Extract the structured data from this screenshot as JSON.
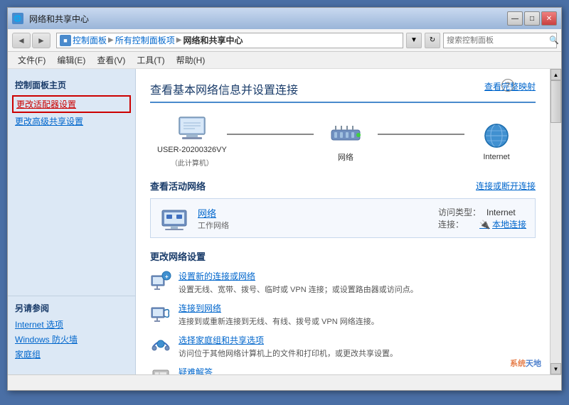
{
  "window": {
    "title": "网络和共享中心",
    "title_buttons": {
      "minimize": "—",
      "maximize": "□",
      "close": "✕"
    }
  },
  "address_bar": {
    "nav_back": "◄",
    "nav_fwd": "►",
    "breadcrumb_icon": "■",
    "breadcrumb_items": [
      "控制面板",
      "所有控制面板项",
      "网络和共享中心"
    ],
    "separator": "▶",
    "arrow_label": "▼",
    "search_placeholder": "搜索控制面板",
    "search_icon": "🔍"
  },
  "menu_bar": {
    "items": [
      "文件(F)",
      "编辑(E)",
      "查看(V)",
      "工具(T)",
      "帮助(H)"
    ]
  },
  "sidebar": {
    "section_title": "控制面板主页",
    "links": [
      {
        "label": "更改适配器设置",
        "highlighted": true
      },
      {
        "label": "更改高级共享设置",
        "highlighted": false
      }
    ],
    "also_section_title": "另请参阅",
    "also_links": [
      "Internet 选项",
      "Windows 防火墙",
      "家庭组"
    ]
  },
  "content": {
    "title": "查看基本网络信息并设置连接",
    "view_map_link": "查看完整映射",
    "network_nodes": [
      {
        "label": "USER-20200326VY",
        "sublabel": "（此计算机）"
      },
      {
        "label": "网络",
        "sublabel": ""
      },
      {
        "label": "Internet",
        "sublabel": ""
      }
    ],
    "active_networks_section": "查看活动网络",
    "disconnect_link": "连接或断开连接",
    "active_network": {
      "name": "网络",
      "type": "工作网络",
      "access_type_label": "访问类型：",
      "access_type_value": "Internet",
      "connection_label": "连接：",
      "connection_value": "本地连接"
    },
    "change_settings_title": "更改网络设置",
    "settings_items": [
      {
        "title": "设置新的连接或网络",
        "desc": "设置无线、宽带、拨号、临时或 VPN 连接；或设置路由器或访问点。"
      },
      {
        "title": "连接到网络",
        "desc": "连接到或重新连接到无线、有线、拨号或 VPN 网络连接。"
      },
      {
        "title": "选择家庭组和共享选项",
        "desc": "访问位于其他网络计算机上的文件和打印机，或更改共享设置。"
      },
      {
        "title": "疑难解答",
        "desc": ""
      }
    ]
  },
  "watermark": {
    "text": "系统天地",
    "prefix": "系统天地"
  },
  "help_icon": "?"
}
